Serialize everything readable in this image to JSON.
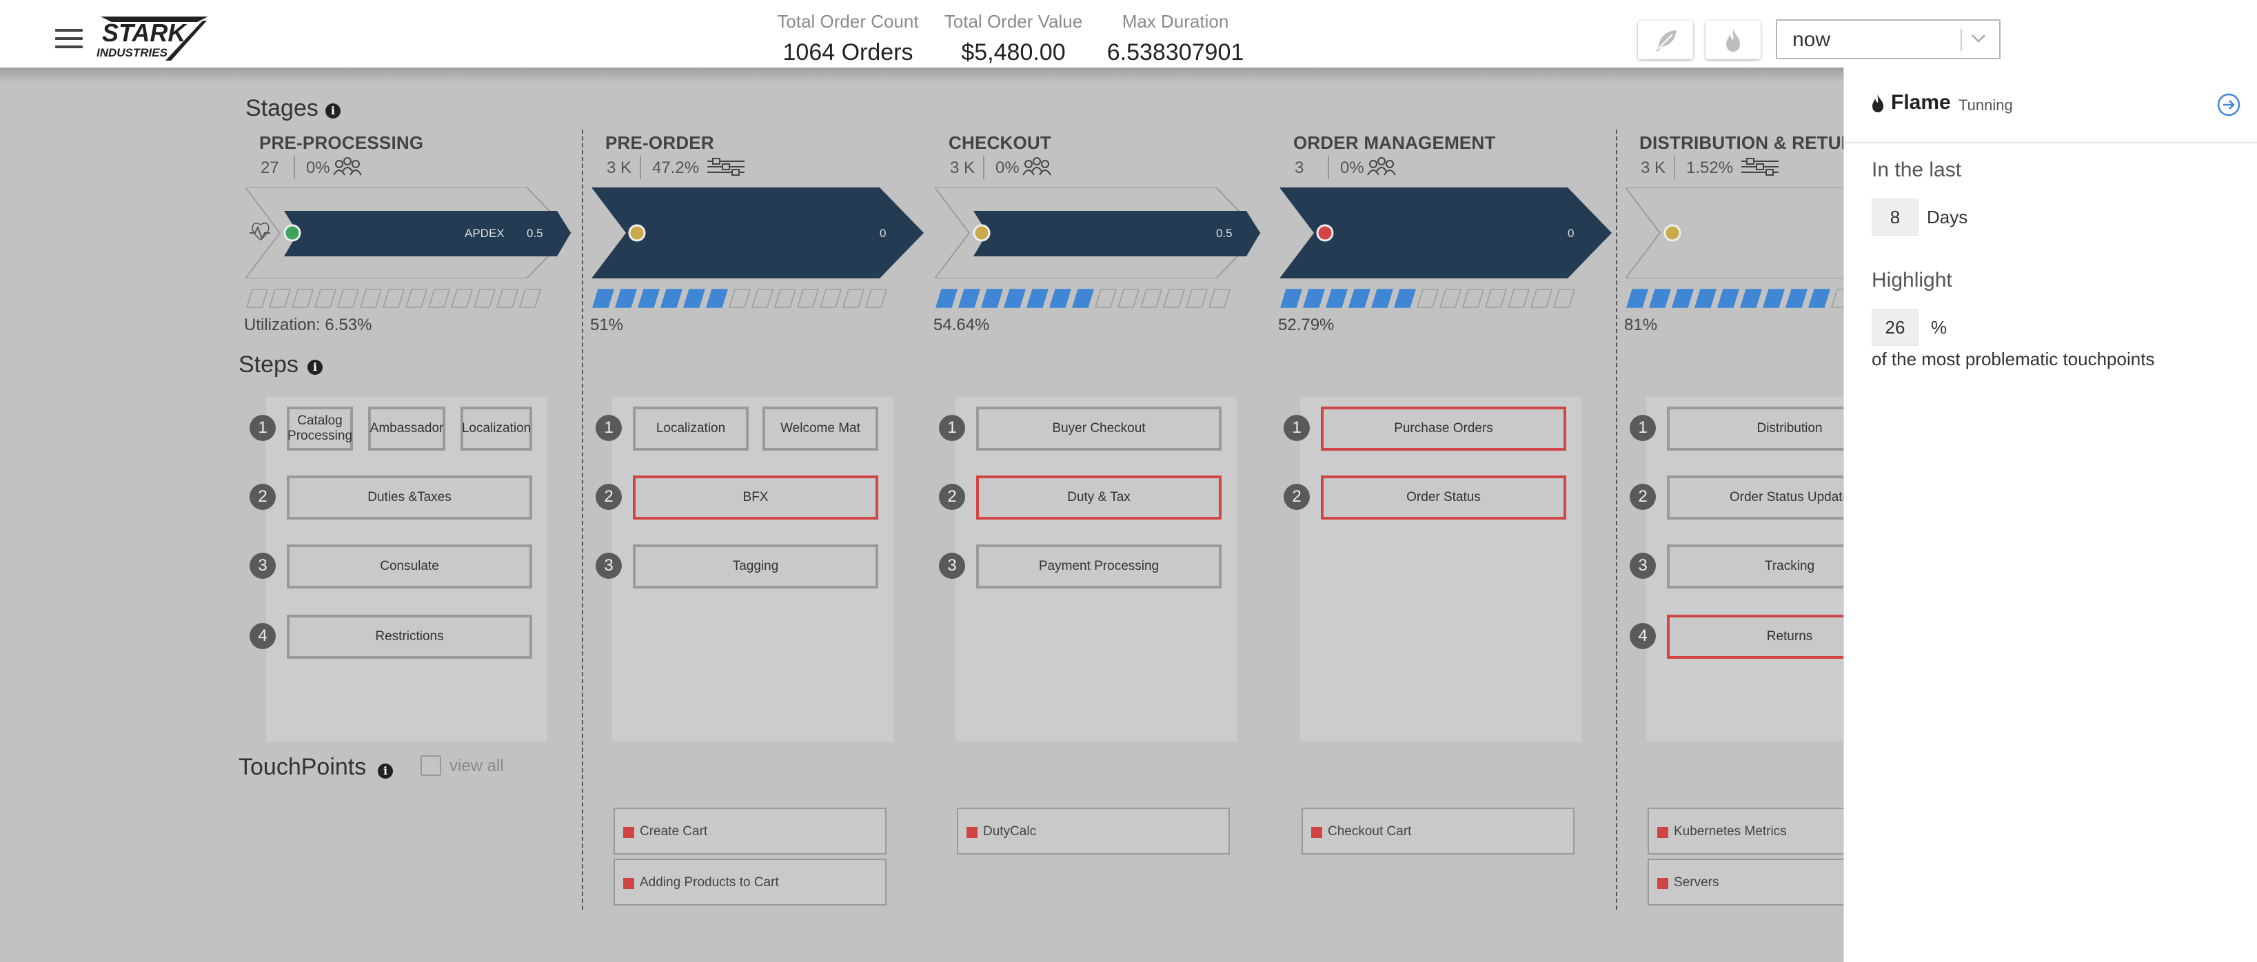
{
  "header": {
    "logo_text": "STARK INDUSTRIES",
    "stats": [
      {
        "label": "Total Order Count",
        "value": "1064 Orders"
      },
      {
        "label": "Total Order Value",
        "value": "$5,480.00"
      },
      {
        "label": "Max Duration",
        "value": "6.538307901"
      }
    ],
    "time_select": {
      "value": "now"
    }
  },
  "sections": {
    "stages": "Stages",
    "steps": "Steps",
    "touchpoints": "TouchPoints",
    "view_all": "view all"
  },
  "stages": [
    {
      "name": "PRE-PROCESSING",
      "count": "27",
      "pct": "0%",
      "apdex_label": "APDEX",
      "apdex_value": "0.5",
      "dot_color": "#3ea35a",
      "style": "outline",
      "segments_filled": 0,
      "util": "Utilization: 6.53%",
      "steps": [
        [
          {
            "label": "Catalog Processing",
            "red": false
          },
          {
            "label": "Ambassador",
            "red": false
          },
          {
            "label": "Localization",
            "red": false
          }
        ],
        [
          {
            "label": "Duties &Taxes",
            "red": false
          }
        ],
        [
          {
            "label": "Consulate",
            "red": false
          }
        ],
        [
          {
            "label": "Restrictions",
            "red": false
          }
        ]
      ],
      "touchpoints": []
    },
    {
      "name": "PRE-ORDER",
      "count": "3 K",
      "pct": "47.2%",
      "apdex_value": "0",
      "dot_color": "#caa94a",
      "style": "filled",
      "segments_filled": 6,
      "util": "51%",
      "steps": [
        [
          {
            "label": "Localization",
            "red": false
          },
          {
            "label": "Welcome Mat",
            "red": false
          }
        ],
        [
          {
            "label": "BFX",
            "red": true
          }
        ],
        [
          {
            "label": "Tagging",
            "red": false
          }
        ]
      ],
      "touchpoints": [
        "Create Cart",
        "Adding Products to Cart"
      ]
    },
    {
      "name": "CHECKOUT",
      "count": "3 K",
      "pct": "0%",
      "apdex_value": "0.5",
      "dot_color": "#caa94a",
      "style": "filled-outline",
      "segments_filled": 7,
      "util": "54.64%",
      "steps": [
        [
          {
            "label": "Buyer Checkout",
            "red": false
          }
        ],
        [
          {
            "label": "Duty & Tax",
            "red": true
          }
        ],
        [
          {
            "label": "Payment Processing",
            "red": false
          }
        ]
      ],
      "touchpoints": [
        "DutyCalc"
      ]
    },
    {
      "name": "ORDER MANAGEMENT",
      "count": "3",
      "pct": "0%",
      "apdex_value": "0",
      "dot_color": "#d24545",
      "style": "filled",
      "segments_filled": 6,
      "util": "52.79%",
      "steps": [
        [
          {
            "label": "Purchase Orders",
            "red": true
          }
        ],
        [
          {
            "label": "Order Status",
            "red": true
          }
        ]
      ],
      "touchpoints": [
        "Checkout Cart"
      ]
    },
    {
      "name": "DISTRIBUTION & RETURNS",
      "count": "3 K",
      "pct": "1.52%",
      "dot_color": "#caa94a",
      "style": "outline-open",
      "segments_filled": 9,
      "util": "81%",
      "steps": [
        [
          {
            "label": "Distribution",
            "red": false
          }
        ],
        [
          {
            "label": "Order Status Update",
            "red": false
          }
        ],
        [
          {
            "label": "Tracking",
            "red": false
          }
        ],
        [
          {
            "label": "Returns",
            "red": true
          }
        ]
      ],
      "touchpoints": [
        "Kubernetes Metrics",
        "Servers"
      ]
    }
  ],
  "panel": {
    "title": "Flame",
    "subtitle": "Tunning",
    "in_last_label": "In the last",
    "days_value": "8",
    "days_unit": "Days",
    "highlight_label": "Highlight",
    "highlight_value": "26",
    "highlight_unit": "%",
    "note": "of the most problematic touchpoints"
  },
  "colors": {
    "chevron_fill": "#243c53",
    "segment_fill": "#3f86d4",
    "red_border": "#d24545"
  }
}
